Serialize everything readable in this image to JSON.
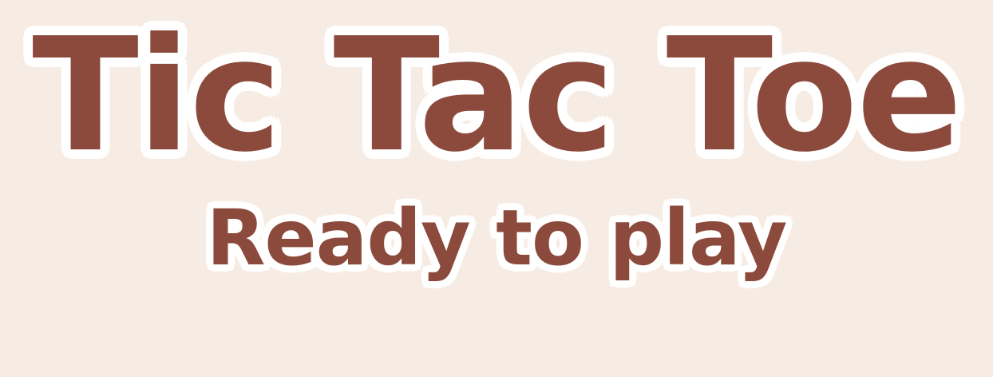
{
  "game": {
    "title": "Tic Tac Toe",
    "status": "Ready to play"
  },
  "colors": {
    "background": "#f6ece3",
    "text": "#8b4a3c",
    "outline": "#ffffff"
  }
}
